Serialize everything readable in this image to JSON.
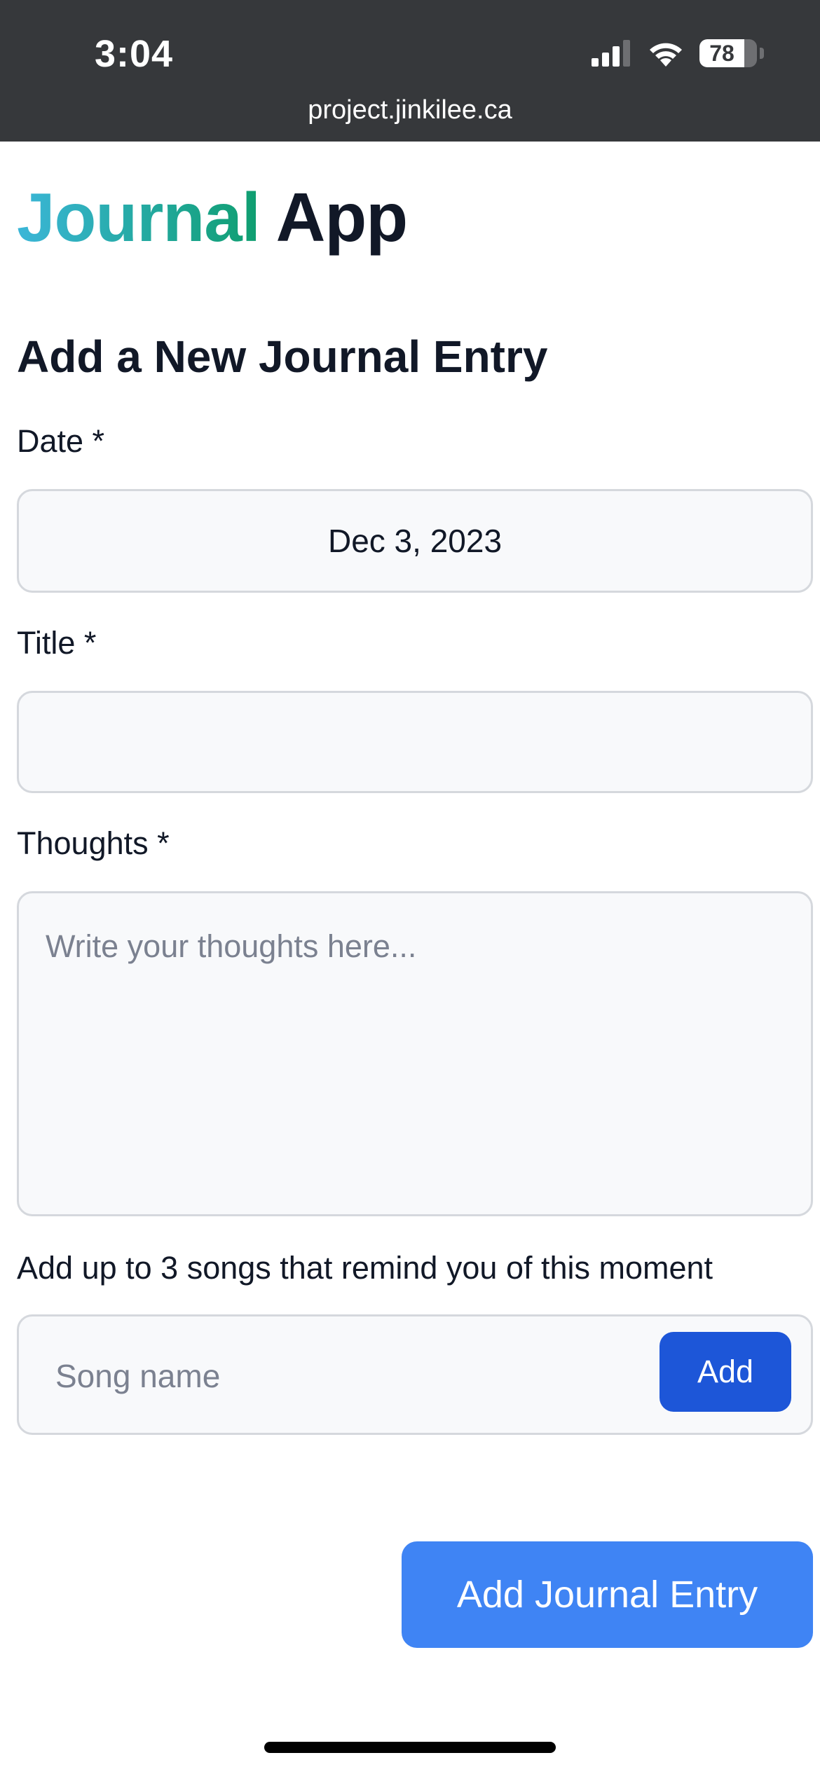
{
  "status_bar": {
    "time": "3:04",
    "battery_level": "78",
    "battery_fraction": 0.78
  },
  "browser": {
    "url": "project.jinkilee.ca"
  },
  "app": {
    "logo_accent": "Journal",
    "logo_rest": "App",
    "accent_gradient": [
      "#3bb6d8",
      "#0f9e6f"
    ]
  },
  "form": {
    "heading": "Add a New Journal Entry",
    "date_label": "Date *",
    "date_value": "Dec 3, 2023",
    "title_label": "Title *",
    "title_value": "",
    "thoughts_label": "Thoughts *",
    "thoughts_placeholder": "Write your thoughts here...",
    "songs_label": "Add up to 3 songs that remind you of this moment",
    "song_placeholder": "Song name",
    "add_song_label": "Add",
    "submit_label": "Add Journal Entry"
  },
  "colors": {
    "add_button": "#1d56d8",
    "submit_button": "#3f84f4",
    "status_bar_bg": "#36383b"
  },
  "icons": [
    "cellular-signal-icon",
    "wifi-icon",
    "battery-icon"
  ]
}
